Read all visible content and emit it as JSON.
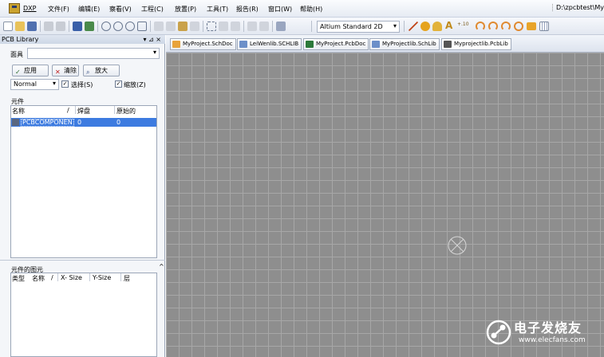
{
  "menubar": {
    "dxp": "DXP",
    "items": [
      "文件(F)",
      "编辑(E)",
      "察看(V)",
      "工程(C)",
      "放置(P)",
      "工具(T)",
      "报告(R)",
      "窗口(W)",
      "帮助(H)"
    ],
    "path": "D:\\zpcbtest\\My"
  },
  "toolbar": {
    "view_mode": "Altium Standard 2D"
  },
  "panel": {
    "title": "PCB Library",
    "title_controls": "▾ ⊿ ×",
    "mask_label": "面具",
    "apply_label": "应用",
    "clear_label": "清除",
    "zoom_label": "放大",
    "mode_value": "Normal",
    "select_label": "选择(S)",
    "zoom_check_label": "缩放(Z)",
    "components": {
      "section_label": "元件",
      "columns": [
        "名称",
        "/",
        "焊盘",
        "原始的"
      ],
      "rows": [
        {
          "name": "PCBCOMPONEN",
          "pads": "0",
          "primitives": "0"
        }
      ]
    },
    "primitives": {
      "section_label": "元件的图元",
      "columns": [
        "类型",
        "名称",
        "/",
        "X- Size",
        "Y-Size",
        "层"
      ]
    }
  },
  "tabs": [
    {
      "label": "MyProject.SchDoc",
      "color": "#e8a33b"
    },
    {
      "label": "LeiWenlib.SCHLIB",
      "color": "#6c8fc9"
    },
    {
      "label": "MyProject.PcbDoc",
      "color": "#2c7a3a"
    },
    {
      "label": "MyProjectlib.SchLib",
      "color": "#6c8fc9"
    },
    {
      "label": "Myprojectlib.PcbLib",
      "color": "#555555"
    }
  ],
  "watermark": {
    "text": "电子发烧友",
    "url": "www.elecfans.com"
  },
  "colors": {
    "canvas_bg": "#8e8e8e",
    "grid_line": "#a7a7a7",
    "selection": "#3d7be0"
  }
}
